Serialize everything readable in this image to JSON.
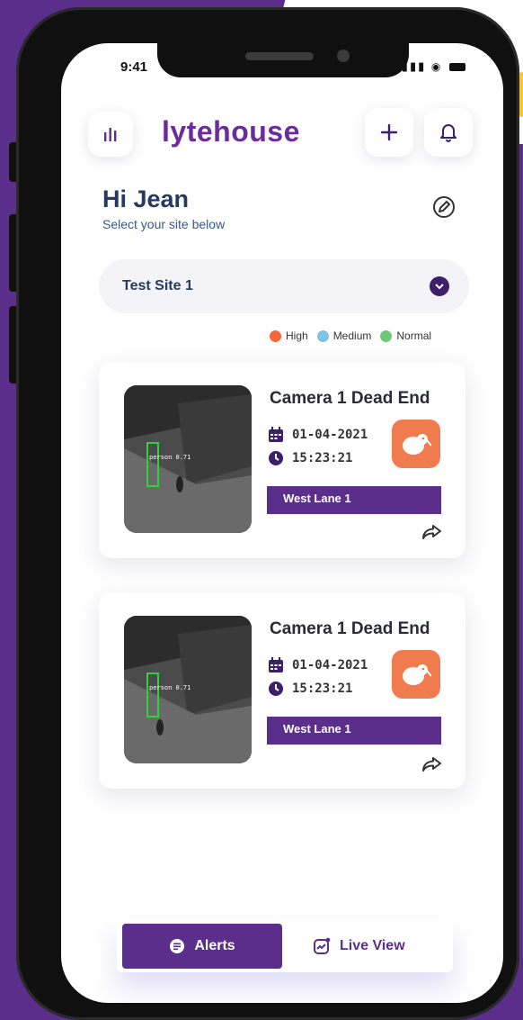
{
  "status_bar": {
    "time": "9:41"
  },
  "header": {
    "logo": "lytehouse",
    "menu_icon": "bars-icon",
    "add_icon": "plus-icon",
    "bell_icon": "bell-icon"
  },
  "greeting": {
    "title": "Hi Jean",
    "subtitle": "Select your site below"
  },
  "site_selector": {
    "value": "Test Site 1"
  },
  "legend": [
    {
      "label": "High",
      "color": "#f2683c"
    },
    {
      "label": "Medium",
      "color": "#7cc3e6"
    },
    {
      "label": "Normal",
      "color": "#6cc97c"
    }
  ],
  "cards": [
    {
      "title": "Camera 1 Dead End",
      "date": "01-04-2021",
      "time": "15:23:21",
      "lane": "West Lane 1",
      "detection": "person 0.71"
    },
    {
      "title": "Camera 1 Dead End",
      "date": "01-04-2021",
      "time": "15:23:21",
      "lane": "West Lane 1",
      "detection": "person 0.71"
    }
  ],
  "bottom_nav": {
    "alerts": "Alerts",
    "live_view": "Live View"
  },
  "colors": {
    "brand": "#5b2e8c",
    "alert": "#f07b4e",
    "text_dark": "#243a63"
  }
}
